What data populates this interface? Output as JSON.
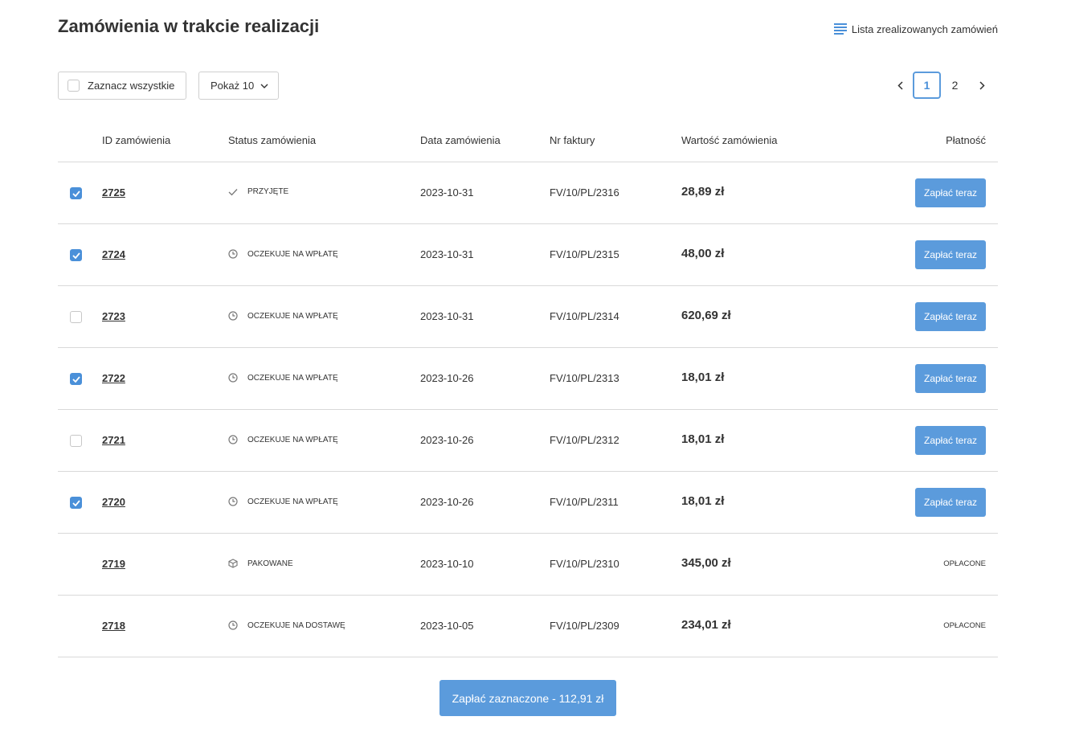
{
  "header": {
    "title": "Zamówienia w trakcie realizacji",
    "completed_link": "Lista zrealizowanych zamówień"
  },
  "toolbar": {
    "select_all_label": "Zaznacz wszystkie",
    "per_page_label": "Pokaż 10",
    "pagination": {
      "pages": [
        "1",
        "2"
      ],
      "current": "1"
    }
  },
  "table": {
    "columns": [
      "ID zamówienia",
      "Status zamówienia",
      "Data zamówienia",
      "Nr faktury",
      "Wartość zamówienia",
      "Płatność"
    ],
    "rows": [
      {
        "id": "2725",
        "status": "PRZYJĘTE",
        "status_icon": "check-icon",
        "date": "2023-10-31",
        "invoice": "FV/10/PL/2316",
        "value": "28,89 zł",
        "payment": "Zapłać teraz",
        "payable": true,
        "checked": true
      },
      {
        "id": "2724",
        "status": "OCZEKUJE NA WPŁATĘ",
        "status_icon": "clock-icon",
        "date": "2023-10-31",
        "invoice": "FV/10/PL/2315",
        "value": "48,00 zł",
        "payment": "Zapłać teraz",
        "payable": true,
        "checked": true
      },
      {
        "id": "2723",
        "status": "OCZEKUJE NA WPŁATĘ",
        "status_icon": "clock-icon",
        "date": "2023-10-31",
        "invoice": "FV/10/PL/2314",
        "value": "620,69 zł",
        "payment": "Zapłać teraz",
        "payable": true,
        "checked": false
      },
      {
        "id": "2722",
        "status": "OCZEKUJE NA WPŁATĘ",
        "status_icon": "clock-icon",
        "date": "2023-10-26",
        "invoice": "FV/10/PL/2313",
        "value": "18,01 zł",
        "payment": "Zapłać teraz",
        "payable": true,
        "checked": true
      },
      {
        "id": "2721",
        "status": "OCZEKUJE NA WPŁATĘ",
        "status_icon": "clock-icon",
        "date": "2023-10-26",
        "invoice": "FV/10/PL/2312",
        "value": "18,01 zł",
        "payment": "Zapłać teraz",
        "payable": true,
        "checked": false
      },
      {
        "id": "2720",
        "status": "OCZEKUJE NA WPŁATĘ",
        "status_icon": "clock-icon",
        "date": "2023-10-26",
        "invoice": "FV/10/PL/2311",
        "value": "18,01 zł",
        "payment": "Zapłać teraz",
        "payable": true,
        "checked": true
      },
      {
        "id": "2719",
        "status": "PAKOWANE",
        "status_icon": "package-icon",
        "date": "2023-10-10",
        "invoice": "FV/10/PL/2310",
        "value": "345,00 zł",
        "payment": "OPŁACONE",
        "payable": false,
        "checked": false
      },
      {
        "id": "2718",
        "status": "OCZEKUJE NA DOSTAWĘ",
        "status_icon": "clock-icon",
        "date": "2023-10-05",
        "invoice": "FV/10/PL/2309",
        "value": "234,01 zł",
        "payment": "OPŁACONE",
        "payable": false,
        "checked": false
      }
    ]
  },
  "footer": {
    "pay_selected_label": "Zapłać zaznaczone - 112,91 zł"
  },
  "colors": {
    "accent": "#5b9bdc",
    "checkbox_checked": "#4a90d9",
    "divider": "#d9d9d9"
  }
}
